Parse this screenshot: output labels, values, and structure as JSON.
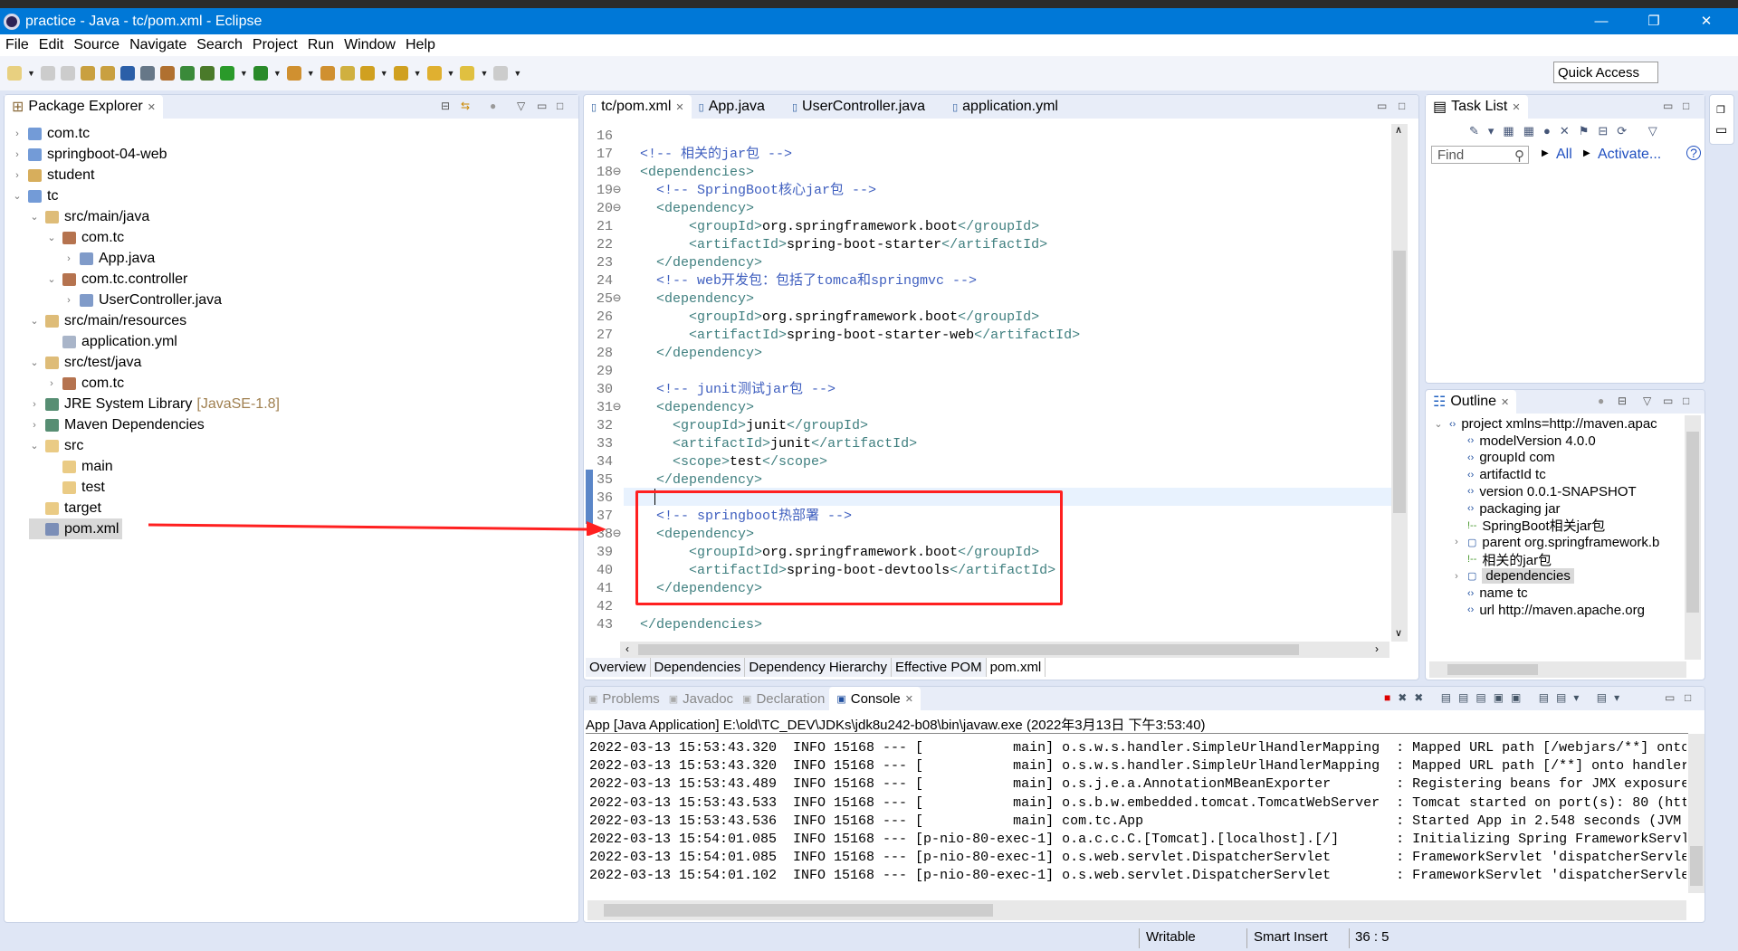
{
  "window": {
    "title": "practice - Java - tc/pom.xml - Eclipse",
    "minimize": "—",
    "restore": "❐",
    "close": "✕"
  },
  "menu": [
    "File",
    "Edit",
    "Source",
    "Navigate",
    "Search",
    "Project",
    "Run",
    "Window",
    "Help"
  ],
  "toolbar": {
    "quick_access": "Quick Access"
  },
  "package_explorer": {
    "title": "Package Explorer",
    "items": [
      {
        "label": "com.tc",
        "level": 0,
        "arrow": "›",
        "icon": "maven-project"
      },
      {
        "label": "springboot-04-web",
        "level": 0,
        "arrow": "›",
        "icon": "maven-project"
      },
      {
        "label": "student",
        "level": 0,
        "arrow": "›",
        "icon": "project"
      },
      {
        "label": "tc",
        "level": 0,
        "arrow": "⌄",
        "icon": "maven-project"
      },
      {
        "label": "src/main/java",
        "level": 1,
        "arrow": "⌄",
        "icon": "source-folder"
      },
      {
        "label": "com.tc",
        "level": 2,
        "arrow": "⌄",
        "icon": "package"
      },
      {
        "label": "App.java",
        "level": 3,
        "arrow": "›",
        "icon": "java-file"
      },
      {
        "label": "com.tc.controller",
        "level": 2,
        "arrow": "⌄",
        "icon": "package"
      },
      {
        "label": "UserController.java",
        "level": 3,
        "arrow": "›",
        "icon": "java-file"
      },
      {
        "label": "src/main/resources",
        "level": 1,
        "arrow": "⌄",
        "icon": "source-folder"
      },
      {
        "label": "application.yml",
        "level": 2,
        "arrow": "",
        "icon": "text-file"
      },
      {
        "label": "src/test/java",
        "level": 1,
        "arrow": "⌄",
        "icon": "source-folder"
      },
      {
        "label": "com.tc",
        "level": 2,
        "arrow": "›",
        "icon": "package"
      },
      {
        "label": "JRE System Library",
        "suffix": "[JavaSE-1.8]",
        "level": 1,
        "arrow": "›",
        "icon": "library"
      },
      {
        "label": "Maven Dependencies",
        "level": 1,
        "arrow": "›",
        "icon": "library"
      },
      {
        "label": "src",
        "level": 1,
        "arrow": "⌄",
        "icon": "folder"
      },
      {
        "label": "main",
        "level": 2,
        "arrow": "",
        "icon": "folder"
      },
      {
        "label": "test",
        "level": 2,
        "arrow": "",
        "icon": "folder"
      },
      {
        "label": "target",
        "level": 1,
        "arrow": "",
        "icon": "folder"
      },
      {
        "label": "pom.xml",
        "level": 1,
        "arrow": "",
        "icon": "pom-file",
        "selected": true
      }
    ]
  },
  "editor": {
    "tabs": [
      {
        "label": "tc/pom.xml",
        "active": true
      },
      {
        "label": "App.java"
      },
      {
        "label": "UserController.java"
      },
      {
        "label": "application.yml"
      }
    ],
    "lines": [
      {
        "n": "16",
        "t": ""
      },
      {
        "n": "17",
        "t": "<!-- 相关的jar包 -->"
      },
      {
        "n": "18⊖",
        "t": "<dependencies>"
      },
      {
        "n": "19⊖",
        "t": "  <!-- SpringBoot核心jar包 -->"
      },
      {
        "n": "20⊖",
        "t": "  <dependency>"
      },
      {
        "n": "21",
        "t": "      <groupId>org.springframework.boot</groupId>"
      },
      {
        "n": "22",
        "t": "      <artifactId>spring-boot-starter</artifactId>"
      },
      {
        "n": "23",
        "t": "  </dependency>"
      },
      {
        "n": "24",
        "t": "  <!-- web开发包：包括了tomca和springmvc -->"
      },
      {
        "n": "25⊖",
        "t": "  <dependency>"
      },
      {
        "n": "26",
        "t": "      <groupId>org.springframework.boot</groupId>"
      },
      {
        "n": "27",
        "t": "      <artifactId>spring-boot-starter-web</artifactId>"
      },
      {
        "n": "28",
        "t": "  </dependency>"
      },
      {
        "n": "29",
        "t": ""
      },
      {
        "n": "30",
        "t": "  <!-- junit测试jar包 -->"
      },
      {
        "n": "31⊖",
        "t": "  <dependency>"
      },
      {
        "n": "32",
        "t": "    <groupId>junit</groupId>"
      },
      {
        "n": "33",
        "t": "    <artifactId>junit</artifactId>"
      },
      {
        "n": "34",
        "t": "    <scope>test</scope>"
      },
      {
        "n": "35",
        "t": "  </dependency>"
      },
      {
        "n": "36",
        "t": "  "
      },
      {
        "n": "37",
        "t": "  <!-- springboot热部署 -->"
      },
      {
        "n": "38⊖",
        "t": "  <dependency>"
      },
      {
        "n": "39",
        "t": "      <groupId>org.springframework.boot</groupId>"
      },
      {
        "n": "40",
        "t": "      <artifactId>spring-boot-devtools</artifactId>"
      },
      {
        "n": "41",
        "t": "  </dependency>"
      },
      {
        "n": "42",
        "t": ""
      },
      {
        "n": "43",
        "t": "</dependencies>"
      }
    ],
    "bottom_tabs": [
      "Overview",
      "Dependencies",
      "Dependency Hierarchy",
      "Effective POM",
      "pom.xml"
    ]
  },
  "task_list": {
    "title": "Task List",
    "find_placeholder": "Find",
    "all": "All",
    "activate": "Activate..."
  },
  "outline": {
    "title": "Outline",
    "items": [
      {
        "label": "project xmlns=http://maven.apac",
        "arrow": "⌄",
        "icon": "element",
        "indent": 0
      },
      {
        "label": "modelVersion  4.0.0",
        "icon": "element",
        "indent": 1
      },
      {
        "label": "groupId  com",
        "icon": "element",
        "indent": 1
      },
      {
        "label": "artifactId  tc",
        "icon": "element",
        "indent": 1
      },
      {
        "label": "version  0.0.1-SNAPSHOT",
        "icon": "element",
        "indent": 1
      },
      {
        "label": "packaging  jar",
        "icon": "element",
        "indent": 1
      },
      {
        "label": "SpringBoot相关jar包",
        "icon": "comment",
        "indent": 1
      },
      {
        "label": "parent  org.springframework.b",
        "arrow": "›",
        "icon": "parent",
        "indent": 1
      },
      {
        "label": "相关的jar包",
        "icon": "comment",
        "indent": 1
      },
      {
        "label": "dependencies",
        "arrow": "›",
        "icon": "dependencies",
        "indent": 1,
        "selected": true
      },
      {
        "label": "name  tc",
        "icon": "element",
        "indent": 1
      },
      {
        "label": "url  http://maven.apache.org",
        "icon": "element",
        "indent": 1
      }
    ]
  },
  "console": {
    "tabs": [
      "Problems",
      "Javadoc",
      "Declaration",
      "Console"
    ],
    "active_tab": "Console",
    "header": "App [Java Application] E:\\old\\TC_DEV\\JDKs\\jdk8u242-b08\\bin\\javaw.exe (2022年3月13日 下午3:53:40)",
    "lines": [
      "2022-03-13 15:53:43.320  INFO 15168 --- [           main] o.s.w.s.handler.SimpleUrlHandlerMapping  : Mapped URL path [/webjars/**] onto",
      "2022-03-13 15:53:43.320  INFO 15168 --- [           main] o.s.w.s.handler.SimpleUrlHandlerMapping  : Mapped URL path [/**] onto handler",
      "2022-03-13 15:53:43.489  INFO 15168 --- [           main] o.s.j.e.a.AnnotationMBeanExporter        : Registering beans for JMX exposure",
      "2022-03-13 15:53:43.533  INFO 15168 --- [           main] o.s.b.w.embedded.tomcat.TomcatWebServer  : Tomcat started on port(s): 80 (htt",
      "2022-03-13 15:53:43.536  INFO 15168 --- [           main] com.tc.App                               : Started App in 2.548 seconds (JVM",
      "2022-03-13 15:54:01.085  INFO 15168 --- [p-nio-80-exec-1] o.a.c.c.C.[Tomcat].[localhost].[/]       : Initializing Spring FrameworkServl",
      "2022-03-13 15:54:01.085  INFO 15168 --- [p-nio-80-exec-1] o.s.web.servlet.DispatcherServlet        : FrameworkServlet 'dispatcherServle",
      "2022-03-13 15:54:01.102  INFO 15168 --- [p-nio-80-exec-1] o.s.web.servlet.DispatcherServlet        : FrameworkServlet 'dispatcherServle"
    ]
  },
  "status": {
    "writable": "Writable",
    "insert_mode": "Smart Insert",
    "position": "36 : 5"
  },
  "colors": {
    "title_bar": "#0078d7",
    "annotation": "#ff2020",
    "xml_tag": "#3f7f7f",
    "xml_comment": "#3f5fbf"
  }
}
